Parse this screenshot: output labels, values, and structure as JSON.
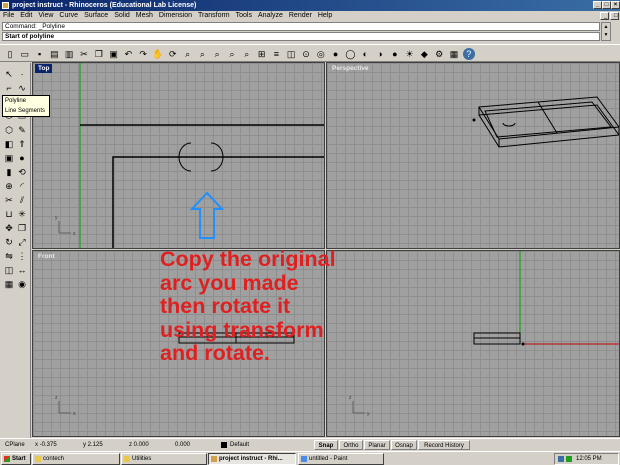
{
  "window": {
    "title": "project instruct - Rhinoceros (Educational Lab License)"
  },
  "menu": [
    "File",
    "Edit",
    "View",
    "Curve",
    "Surface",
    "Solid",
    "Mesh",
    "Dimension",
    "Transform",
    "Tools",
    "Analyze",
    "Render",
    "Help"
  ],
  "command": {
    "history": "Command: _Polyline",
    "prompt": "Start of polyline"
  },
  "toolbar_icons": [
    "new-file-icon",
    "open-file-icon",
    "save-icon",
    "print-icon",
    "import-icon",
    "cut-icon",
    "copy-icon",
    "paste-icon",
    "undo-icon",
    "redo-icon",
    "pan-icon",
    "rotate-view-icon",
    "zoom-dynamic-icon",
    "zoom-window-icon",
    "zoom-extents-icon",
    "zoom-selected-icon",
    "zoom-all-icon",
    "viewport-layout-icon",
    "layers-icon",
    "properties-icon",
    "select-point-icon",
    "osnap-icon",
    "object-properties-icon",
    "wireframe-icon",
    "shaded-icon",
    "rendered-icon",
    "render-sphere-icon",
    "light-icon",
    "material-icon",
    "options-icon",
    "toolbars-icon",
    "help-icon"
  ],
  "tooltip": {
    "items": [
      "Polyline",
      "Line Segments"
    ]
  },
  "viewports": {
    "top": "Top",
    "perspective": "Perspective",
    "front": "Front",
    "right": ""
  },
  "overlay_text": [
    "Copy the original",
    "arc you made",
    "then rotate it",
    "using transform",
    "and rotate."
  ],
  "status": {
    "cplane": "CPlane",
    "x": "x -0.375",
    "y": "y 2.125",
    "z": "z 0.000",
    "dist": "0.000",
    "layer": "Default",
    "snap": "Snap",
    "ortho": "Ortho",
    "planar": "Planar",
    "osnap": "Osnap",
    "record": "Record History"
  },
  "taskbar": {
    "start": "Start",
    "tasks": [
      "contech",
      "Utilities",
      "project instruct - Rhi...",
      "untitled - Paint"
    ],
    "clock": "12:05 PM"
  },
  "colors": {
    "title_bar": "#0a246a",
    "annotation_text": "#e02020",
    "arrow": "#1e90ff",
    "x_axis": "#c00000",
    "y_axis": "#00a000"
  }
}
